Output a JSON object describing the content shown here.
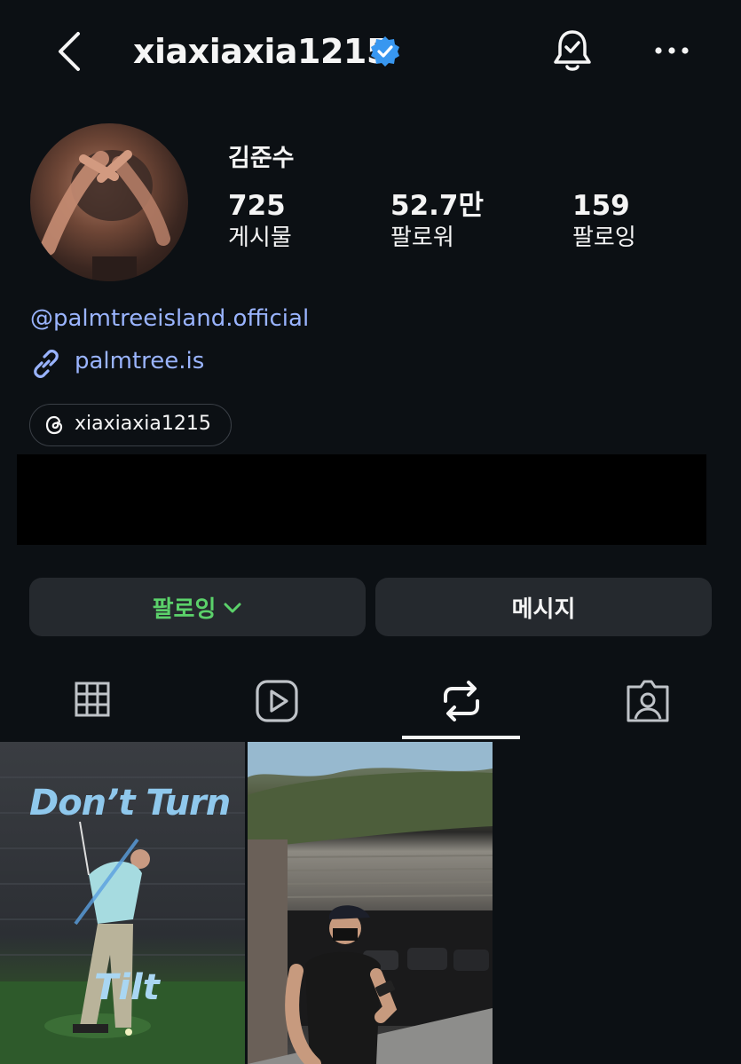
{
  "header": {
    "username": "xiaxiaxia1215",
    "verified": true,
    "icons": [
      "back-chevron-icon",
      "verified-badge-icon",
      "notification-bell-icon",
      "more-options-icon"
    ]
  },
  "profile": {
    "display_name": "김준수",
    "stats": [
      {
        "value": "725",
        "label": "게시물"
      },
      {
        "value": "52.7만",
        "label": "팔로워"
      },
      {
        "value": "159",
        "label": "팔로잉"
      }
    ],
    "mention": "@palmtreeisland.official",
    "link": "palmtree.is",
    "threads_handle": "xiaxiaxia1215"
  },
  "actions": {
    "following_label": "팔로잉",
    "message_label": "메시지",
    "following_color": "#5bd16a"
  },
  "tabs": {
    "items": [
      "grid-icon",
      "reels-icon",
      "reposts-icon",
      "tagged-icon"
    ],
    "active": "reposts-icon"
  },
  "posts": [
    {
      "overlay_title": "Don’t Turn",
      "overlay_sub": "Tilt"
    },
    {
      "overlay_title": "",
      "overlay_sub": ""
    }
  ],
  "colors": {
    "background": "#0c1014",
    "link": "#9ab4ff",
    "button_bg": "#25292e",
    "verified": "#3897f0"
  }
}
